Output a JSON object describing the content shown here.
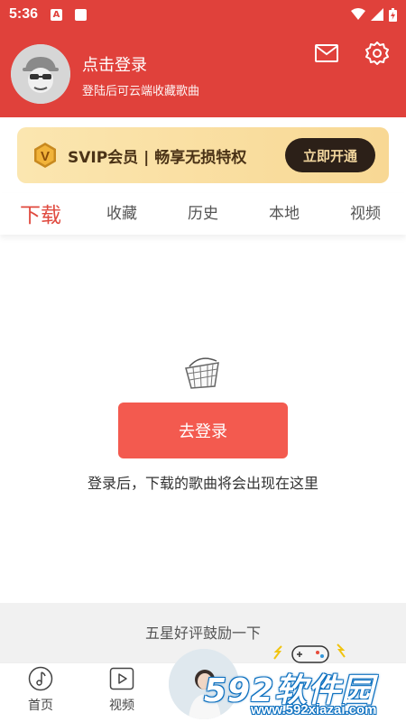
{
  "status_bar": {
    "time": "5:36",
    "a_icon_text": "A"
  },
  "header": {
    "title": "点击登录",
    "subtitle": "登陆后可云端收藏歌曲"
  },
  "vip": {
    "badge_letter": "V",
    "text": "SVIP会员 | 畅享无损特权",
    "button": "立即开通"
  },
  "tabs": [
    {
      "label": "下载",
      "active": true
    },
    {
      "label": "收藏",
      "active": false
    },
    {
      "label": "历史",
      "active": false
    },
    {
      "label": "本地",
      "active": false
    },
    {
      "label": "视频",
      "active": false
    }
  ],
  "empty_state": {
    "button": "去登录",
    "message": "登录后，下载的歌曲将会出现在这里"
  },
  "rating": {
    "text": "五星好评鼓励一下"
  },
  "bottom_nav": [
    {
      "label": "首页",
      "icon": "music-note-icon"
    },
    {
      "label": "视频",
      "icon": "play-icon"
    }
  ],
  "watermark": {
    "big": "592软件园",
    "small": "www.592xiazai.com"
  },
  "colors": {
    "primary_red": "#e0413b",
    "button_red": "#f35a4f",
    "vip_gold": "#f8d894",
    "vip_dark": "#2c2018"
  }
}
